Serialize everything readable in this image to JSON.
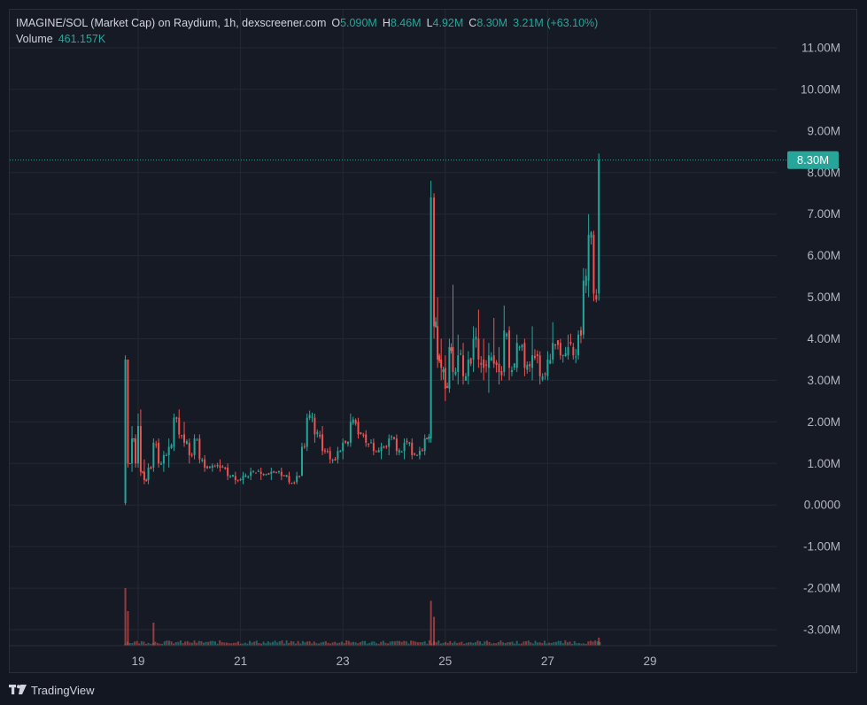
{
  "legend": {
    "title": "IMAGINE/SOL (Market Cap) on Raydium, 1h, dexscreener.com",
    "o_label": "O",
    "o_value": "5.090M",
    "h_label": "H",
    "h_value": "8.46M",
    "l_label": "L",
    "l_value": "4.92M",
    "c_label": "C",
    "c_value": "8.30M",
    "change": "3.21M (+63.10%)",
    "volume_label": "Volume",
    "volume_value": "461.157K"
  },
  "price_tag": "8.30M",
  "footer": {
    "brand": "TradingView",
    "brand_icon": "tradingview-logo-icon"
  },
  "colors": {
    "background": "#131722",
    "up": "#26a69a",
    "down": "#ef5350",
    "grid": "#242833",
    "text": "#b2b5be",
    "price_line": "#26a69a"
  },
  "chart_data": {
    "type": "candlestick",
    "title": "IMAGINE/SOL (Market Cap) on Raydium, 1h, dexscreener.com",
    "y_ticks": [
      "11.00M",
      "10.00M",
      "9.00M",
      "8.00M",
      "7.00M",
      "6.00M",
      "5.00M",
      "4.00M",
      "3.00M",
      "2.00M",
      "1.00M",
      "0.0000",
      "-1.00M",
      "-2.00M",
      "-3.00M"
    ],
    "y_tick_values": [
      11,
      10,
      9,
      8,
      7,
      6,
      5,
      4,
      3,
      2,
      1,
      0,
      -1,
      -2,
      -3
    ],
    "y_unit": "M",
    "ylim": [
      -3.4,
      11.4
    ],
    "x_ticks": [
      "19",
      "21",
      "23",
      "25",
      "27",
      "29"
    ],
    "x_tick_days": [
      19,
      21,
      23,
      25,
      27,
      29
    ],
    "xlim": [
      17.0,
      33.9
    ],
    "last_close": 8.3,
    "grid": true,
    "ohlc_points": [
      [
        18.75,
        0.05,
        3.6,
        0.0,
        3.5
      ],
      [
        18.8,
        3.5,
        3.5,
        0.9,
        1.0
      ],
      [
        18.88,
        1.0,
        1.9,
        0.8,
        1.6
      ],
      [
        18.95,
        1.6,
        1.7,
        0.9,
        1.0
      ],
      [
        19.0,
        1.0,
        2.2,
        0.9,
        1.9
      ],
      [
        19.05,
        1.9,
        2.3,
        0.7,
        0.8
      ],
      [
        19.12,
        0.8,
        1.1,
        0.5,
        0.6
      ],
      [
        19.2,
        0.6,
        1.0,
        0.5,
        0.9
      ],
      [
        19.3,
        0.9,
        1.6,
        0.8,
        1.5
      ],
      [
        19.4,
        1.5,
        1.6,
        0.9,
        1.0
      ],
      [
        19.5,
        1.0,
        1.3,
        0.8,
        1.2
      ],
      [
        19.6,
        1.2,
        1.6,
        0.9,
        1.4
      ],
      [
        19.7,
        1.4,
        2.2,
        1.3,
        2.1
      ],
      [
        19.8,
        2.1,
        2.3,
        1.6,
        1.7
      ],
      [
        19.9,
        1.7,
        2.0,
        1.4,
        1.5
      ],
      [
        20.0,
        1.5,
        1.6,
        1.0,
        1.2
      ],
      [
        20.1,
        1.2,
        1.7,
        1.1,
        1.6
      ],
      [
        20.2,
        1.6,
        1.7,
        1.0,
        1.1
      ],
      [
        20.3,
        1.1,
        1.2,
        0.8,
        0.9
      ],
      [
        20.45,
        0.9,
        1.0,
        0.8,
        0.95
      ],
      [
        20.6,
        0.95,
        1.1,
        0.8,
        0.9
      ],
      [
        20.75,
        0.9,
        1.0,
        0.6,
        0.7
      ],
      [
        20.9,
        0.7,
        0.8,
        0.5,
        0.6
      ],
      [
        21.05,
        0.6,
        0.8,
        0.5,
        0.7
      ],
      [
        21.2,
        0.7,
        0.9,
        0.6,
        0.8
      ],
      [
        21.4,
        0.8,
        0.9,
        0.6,
        0.75
      ],
      [
        21.6,
        0.75,
        0.9,
        0.6,
        0.8
      ],
      [
        21.8,
        0.8,
        0.9,
        0.6,
        0.7
      ],
      [
        21.95,
        0.7,
        0.8,
        0.5,
        0.55
      ],
      [
        22.1,
        0.55,
        0.8,
        0.5,
        0.7
      ],
      [
        22.2,
        0.7,
        1.5,
        0.7,
        1.4
      ],
      [
        22.3,
        1.4,
        2.2,
        1.3,
        2.1
      ],
      [
        22.45,
        2.1,
        2.2,
        1.5,
        1.7
      ],
      [
        22.6,
        1.7,
        1.9,
        1.2,
        1.3
      ],
      [
        22.75,
        1.3,
        1.4,
        1.0,
        1.1
      ],
      [
        22.9,
        1.1,
        1.4,
        1.0,
        1.3
      ],
      [
        23.0,
        1.3,
        1.6,
        1.1,
        1.5
      ],
      [
        23.15,
        1.5,
        2.2,
        1.4,
        2.0
      ],
      [
        23.3,
        2.0,
        2.1,
        1.6,
        1.7
      ],
      [
        23.45,
        1.7,
        1.8,
        1.4,
        1.5
      ],
      [
        23.6,
        1.5,
        1.6,
        1.2,
        1.3
      ],
      [
        23.75,
        1.3,
        1.5,
        1.1,
        1.4
      ],
      [
        23.9,
        1.4,
        1.7,
        1.2,
        1.6
      ],
      [
        24.05,
        1.6,
        1.7,
        1.2,
        1.3
      ],
      [
        24.2,
        1.3,
        1.6,
        1.1,
        1.5
      ],
      [
        24.35,
        1.5,
        1.6,
        1.1,
        1.2
      ],
      [
        24.5,
        1.2,
        1.4,
        1.1,
        1.3
      ],
      [
        24.6,
        1.3,
        1.7,
        1.2,
        1.6
      ],
      [
        24.72,
        1.6,
        7.8,
        1.5,
        7.4
      ],
      [
        24.78,
        7.4,
        7.5,
        4.0,
        4.3
      ],
      [
        24.85,
        4.3,
        5.0,
        3.3,
        3.5
      ],
      [
        24.92,
        3.5,
        4.0,
        3.0,
        3.3
      ],
      [
        25.0,
        3.3,
        3.6,
        2.5,
        2.8
      ],
      [
        25.08,
        2.8,
        4.0,
        2.7,
        3.8
      ],
      [
        25.15,
        3.8,
        5.3,
        3.0,
        3.2
      ],
      [
        25.25,
        3.2,
        4.1,
        2.9,
        3.6
      ],
      [
        25.35,
        3.6,
        3.9,
        2.9,
        3.1
      ],
      [
        25.45,
        3.1,
        3.7,
        2.9,
        3.5
      ],
      [
        25.55,
        3.5,
        4.3,
        3.2,
        4.0
      ],
      [
        25.65,
        4.0,
        4.7,
        3.3,
        3.5
      ],
      [
        25.75,
        3.5,
        4.0,
        3.0,
        3.3
      ],
      [
        25.85,
        3.3,
        3.9,
        2.7,
        3.6
      ],
      [
        25.95,
        3.6,
        4.5,
        3.3,
        3.4
      ],
      [
        26.05,
        3.4,
        3.8,
        2.9,
        3.2
      ],
      [
        26.15,
        3.2,
        4.8,
        3.1,
        4.2
      ],
      [
        26.25,
        4.2,
        4.3,
        3.0,
        3.3
      ],
      [
        26.4,
        3.3,
        4.1,
        3.2,
        3.9
      ],
      [
        26.55,
        3.9,
        4.0,
        3.1,
        3.3
      ],
      [
        26.7,
        3.3,
        4.3,
        3.0,
        3.6
      ],
      [
        26.85,
        3.6,
        3.7,
        2.9,
        3.1
      ],
      [
        27.0,
        3.1,
        3.7,
        3.0,
        3.5
      ],
      [
        27.1,
        3.5,
        4.4,
        3.4,
        3.9
      ],
      [
        27.25,
        3.9,
        4.0,
        3.5,
        3.6
      ],
      [
        27.4,
        3.6,
        4.1,
        3.5,
        3.8
      ],
      [
        27.5,
        3.8,
        3.9,
        3.5,
        3.6
      ],
      [
        27.6,
        3.6,
        4.2,
        3.5,
        4.1
      ],
      [
        27.7,
        4.1,
        5.7,
        4.0,
        5.4
      ],
      [
        27.8,
        5.4,
        7.0,
        5.0,
        6.5
      ],
      [
        27.9,
        6.5,
        6.6,
        4.9,
        5.09
      ],
      [
        28.0,
        5.09,
        8.46,
        4.92,
        8.3
      ]
    ],
    "volume_spikes": [
      [
        18.75,
        1.0
      ],
      [
        18.8,
        0.6
      ],
      [
        19.3,
        0.4
      ],
      [
        24.72,
        0.78
      ],
      [
        24.78,
        0.5
      ],
      [
        28.0,
        0.14
      ]
    ]
  }
}
